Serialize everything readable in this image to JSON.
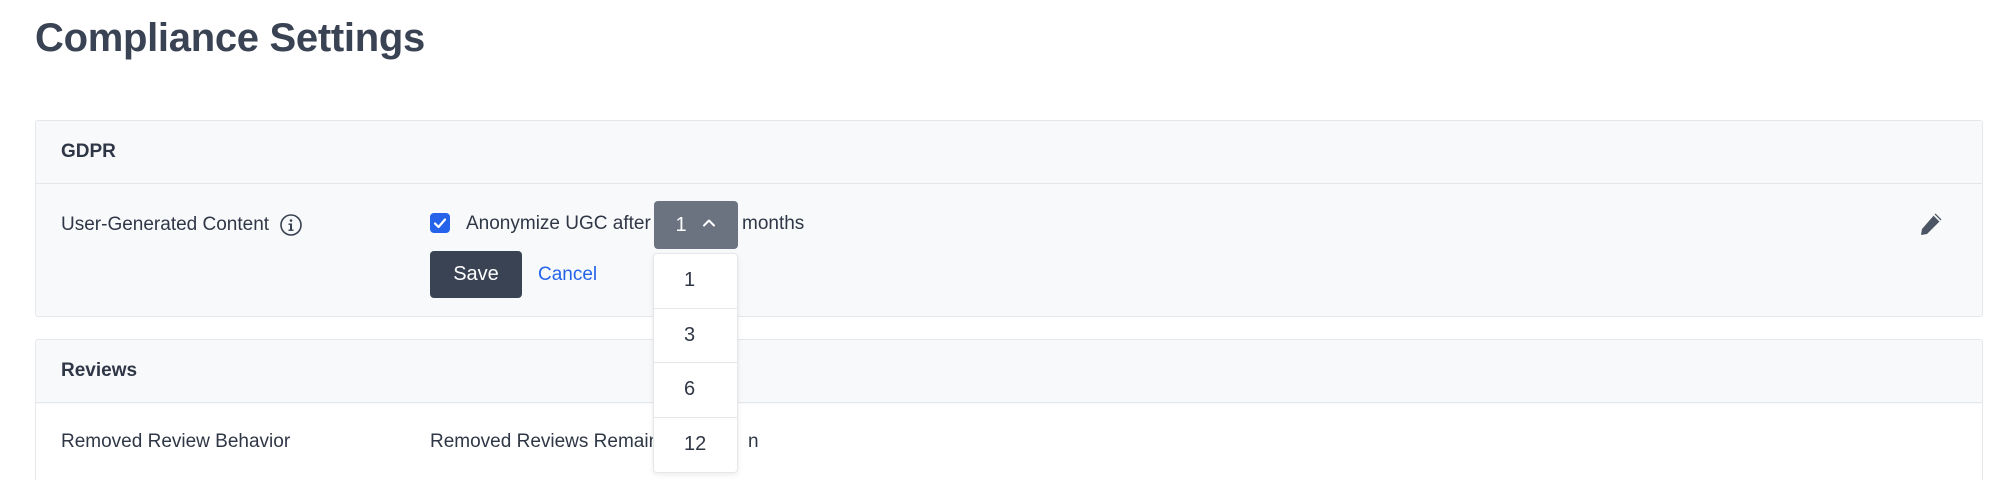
{
  "page": {
    "title": "Compliance Settings"
  },
  "gdpr": {
    "section_title": "GDPR",
    "ugc_label": "User-Generated Content",
    "info_icon": "info-icon",
    "anonymize_checked": true,
    "anonymize_prefix": "Anonymize UGC after",
    "anonymize_suffix": "months",
    "selected_months": "1",
    "options": [
      "1",
      "3",
      "6",
      "12"
    ],
    "save_label": "Save",
    "cancel_label": "Cancel",
    "edit_icon": "pencil-icon"
  },
  "reviews": {
    "section_title": "Reviews",
    "removed_behavior_label": "Removed Review Behavior",
    "removed_behavior_value_prefix": "Removed Reviews Remain",
    "removed_behavior_value_suffix": "n"
  },
  "colors": {
    "primary_button": "#3a4353",
    "link": "#2563eb",
    "select_bg": "#6b7280",
    "panel_bg": "#f8f9fb"
  }
}
